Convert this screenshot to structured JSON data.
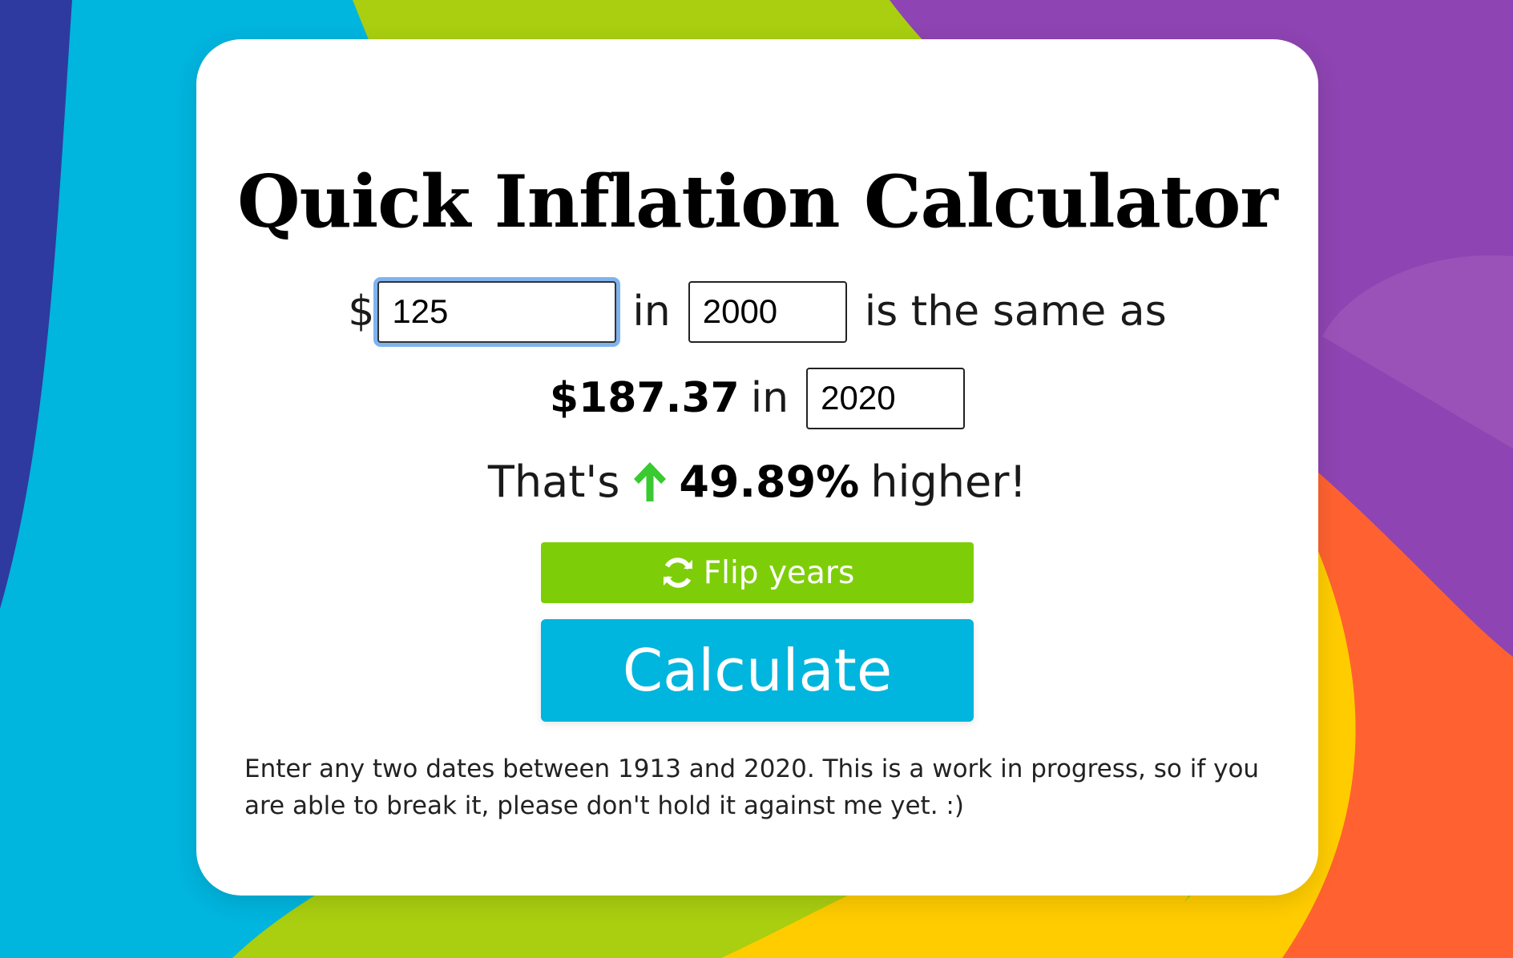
{
  "colors": {
    "background_navy": "#2e3a9f",
    "background_blue": "#00b5de",
    "background_green": "#a9cf10",
    "background_purple": "#8e44b2",
    "background_orange": "#ff6230",
    "background_yellow": "#ffcc00",
    "flip_button": "#7dce08",
    "calculate_button": "#00b5de",
    "focus_ring": "#7fb3ee",
    "increase_arrow": "#39c930"
  },
  "title": "Quick Inflation Calculator",
  "form": {
    "currency_symbol": "$",
    "amount_value": "125",
    "in_label_1": "in",
    "from_year_value": "2000",
    "same_as_label": "is the same as",
    "result_amount": "$187.37",
    "in_label_2": "in",
    "to_year_value": "2020"
  },
  "summary": {
    "prefix": "That's",
    "arrow_icon": "arrow-up-icon",
    "percent": "49.89%",
    "suffix": "higher!"
  },
  "buttons": {
    "flip_icon": "refresh-icon",
    "flip_label": "Flip years",
    "calculate_label": "Calculate"
  },
  "note": "Enter any two dates between 1913 and 2020. This is a work in progress, so if you are able to break it, please don't hold it against me yet. :)"
}
